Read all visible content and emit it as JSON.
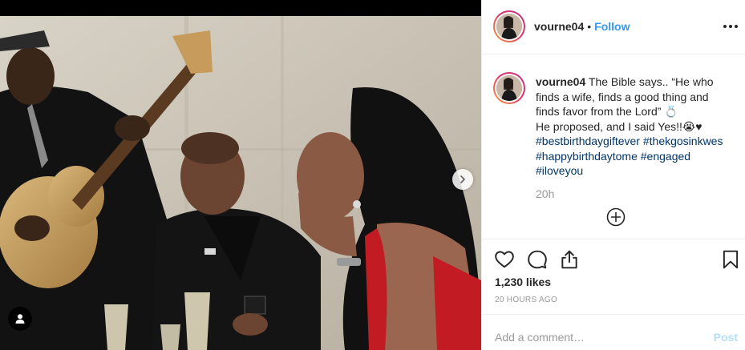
{
  "post": {
    "username": "vourne04",
    "separator": "•",
    "follow_label": "Follow",
    "caption_username": "vourne04",
    "caption_text_1": "The Bible says.. “He who finds a wife, finds a good thing and finds favor from the Lord”",
    "caption_emoji_1": "💍",
    "caption_text_2": "He proposed, and I said Yes!!",
    "caption_emoji_2": "😭♥",
    "hashtags": [
      "#bestbirthdaygiftever",
      "#thekgosinkwes",
      "#happybirthdaytome",
      "#engaged",
      "#iloveyou"
    ],
    "time_ago_short": "20h",
    "likes": "1,230 likes",
    "time_ago_long": "20 HOURS AGO",
    "add_comment_placeholder": "Add a comment…",
    "post_label": "Post"
  },
  "icons": {
    "more": "more-options-icon",
    "next": "chevron-right-icon",
    "tag": "user-tag-icon",
    "load": "plus-circle-icon",
    "like": "heart-icon",
    "comment": "comment-icon",
    "share": "share-icon",
    "save": "bookmark-icon"
  },
  "colors": {
    "link": "#3897f0",
    "hashtag": "#003569",
    "muted": "#999999",
    "post_disabled": "#b2dffc"
  }
}
